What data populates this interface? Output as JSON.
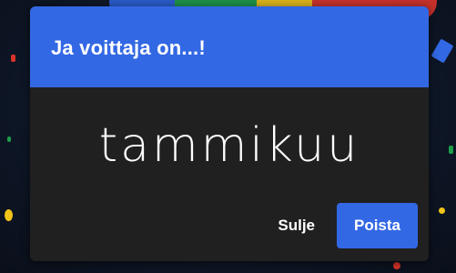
{
  "dialog": {
    "title": "Ja voittaja on...!",
    "winner": "tammikuu",
    "close_label": "Sulje",
    "remove_label": "Poista"
  },
  "colors": {
    "accent": "#3368e4",
    "dialog_background": "#202020",
    "text": "#ffffff"
  }
}
